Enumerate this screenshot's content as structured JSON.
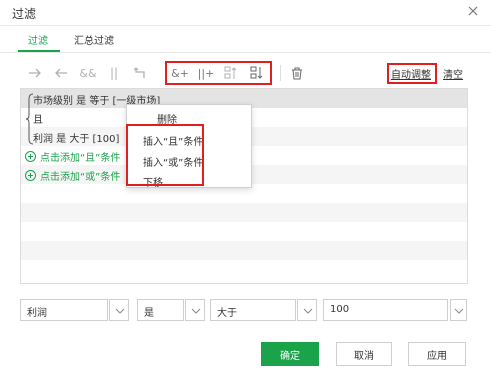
{
  "dialog": {
    "title": "过滤"
  },
  "tabs": [
    {
      "label": "过滤",
      "active": true
    },
    {
      "label": "汇总过滤",
      "active": false
    }
  ],
  "toolbar": {
    "auto_adjust": "自动调整",
    "clear": "清空"
  },
  "conditions": {
    "row1": "市场级别 是 等于 [一级市场]",
    "row2": "且",
    "row3": "利润 是 大于 [100]",
    "add_and": "点击添加“且”条件",
    "add_or": "点击添加“或”条件"
  },
  "context_menu": {
    "delete": "删除",
    "insert_and": "插入“且”条件",
    "insert_or": "插入“或”条件",
    "move_down": "下移"
  },
  "editor": {
    "field": "利润",
    "op1": "是",
    "op2": "大于",
    "value": "100"
  },
  "buttons": {
    "ok": "确定",
    "cancel": "取消",
    "apply": "应用"
  },
  "colors": {
    "accent": "#1aa34a",
    "highlight_border": "#e02020"
  }
}
